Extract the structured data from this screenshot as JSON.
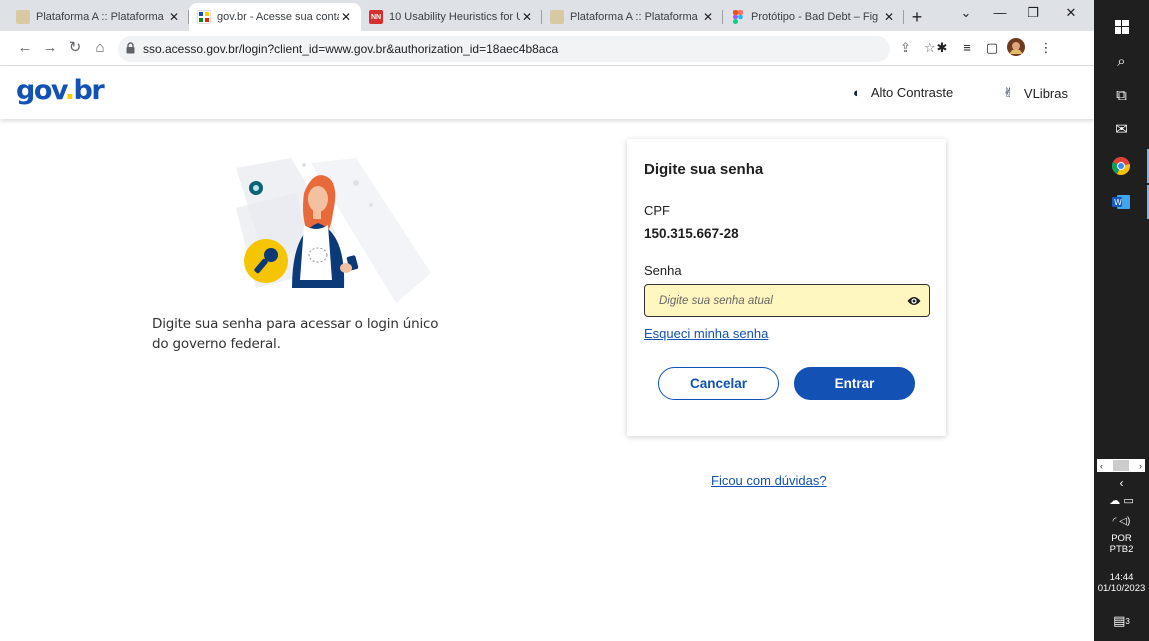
{
  "browser": {
    "tabs": [
      {
        "title": "Plataforma A :: Plataforma",
        "favicon": "platform-favicon",
        "active": false
      },
      {
        "title": "gov.br - Acesse sua conta",
        "favicon": "govbr-favicon",
        "active": true
      },
      {
        "title": "10 Usability Heuristics for U",
        "favicon": "nn-favicon",
        "favicon_text": "NN",
        "active": false
      },
      {
        "title": "Plataforma A :: Plataforma",
        "favicon": "platform-favicon",
        "active": false
      },
      {
        "title": "Protótipo - Bad Debt – Fig",
        "favicon": "figma-favicon",
        "active": false
      }
    ],
    "url": "sso.acesso.gov.br/login?client_id=www.gov.br&authorization_id=18aec4b8aca"
  },
  "header": {
    "logo": "gov.br",
    "contrast_label": "Alto Contraste",
    "vlibras_label": "VLibras"
  },
  "intro": {
    "text": "Digite sua senha para acessar o login único do governo federal."
  },
  "login_card": {
    "title": "Digite sua senha",
    "cpf_label": "CPF",
    "cpf_value": "150.315.667-28",
    "password_label": "Senha",
    "password_placeholder": "Digite sua senha atual",
    "forgot_link": "Esqueci minha senha",
    "cancel_label": "Cancelar",
    "enter_label": "Entrar"
  },
  "help_link": "Ficou com dúvidas?",
  "taskbar": {
    "lang_line1": "POR",
    "lang_line2": "PTB2",
    "time": "14:44",
    "date": "01/10/2023",
    "notification_count": "3"
  },
  "colors": {
    "primary": "#1351b4",
    "input_highlight": "#fff7bf",
    "logo_yellow": "#ffcd07"
  }
}
